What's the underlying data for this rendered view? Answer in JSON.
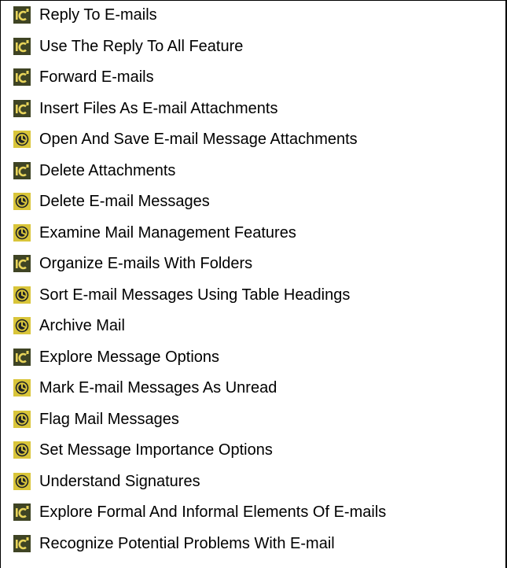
{
  "colors": {
    "ic_icon_bg": "#3f4424",
    "ic_icon_text": "#e8d45a",
    "clock_icon_bg": "#d9c53a",
    "clock_icon_face": "#1e2226"
  },
  "items": [
    {
      "label": "Reply To E-mails",
      "icon": "ic-icon"
    },
    {
      "label": "Use The Reply To All Feature",
      "icon": "ic-icon"
    },
    {
      "label": "Forward E-mails",
      "icon": "ic-icon"
    },
    {
      "label": "Insert Files As E-mail Attachments",
      "icon": "ic-icon"
    },
    {
      "label": "Open And Save E-mail Message Attachments",
      "icon": "clock-icon"
    },
    {
      "label": "Delete Attachments",
      "icon": "ic-icon"
    },
    {
      "label": "Delete E-mail Messages",
      "icon": "clock-icon"
    },
    {
      "label": "Examine Mail Management Features",
      "icon": "clock-icon"
    },
    {
      "label": "Organize E-mails With Folders",
      "icon": "ic-icon"
    },
    {
      "label": "Sort E-mail Messages Using Table Headings",
      "icon": "clock-icon"
    },
    {
      "label": "Archive Mail",
      "icon": "clock-icon"
    },
    {
      "label": "Explore Message Options",
      "icon": "ic-icon"
    },
    {
      "label": "Mark E-mail Messages As Unread",
      "icon": "clock-icon"
    },
    {
      "label": "Flag Mail Messages",
      "icon": "clock-icon"
    },
    {
      "label": "Set Message Importance Options",
      "icon": "clock-icon"
    },
    {
      "label": "Understand Signatures",
      "icon": "clock-icon"
    },
    {
      "label": "Explore Formal And Informal Elements Of E-mails",
      "icon": "ic-icon"
    },
    {
      "label": "Recognize Potential Problems With E-mail",
      "icon": "ic-icon"
    }
  ]
}
